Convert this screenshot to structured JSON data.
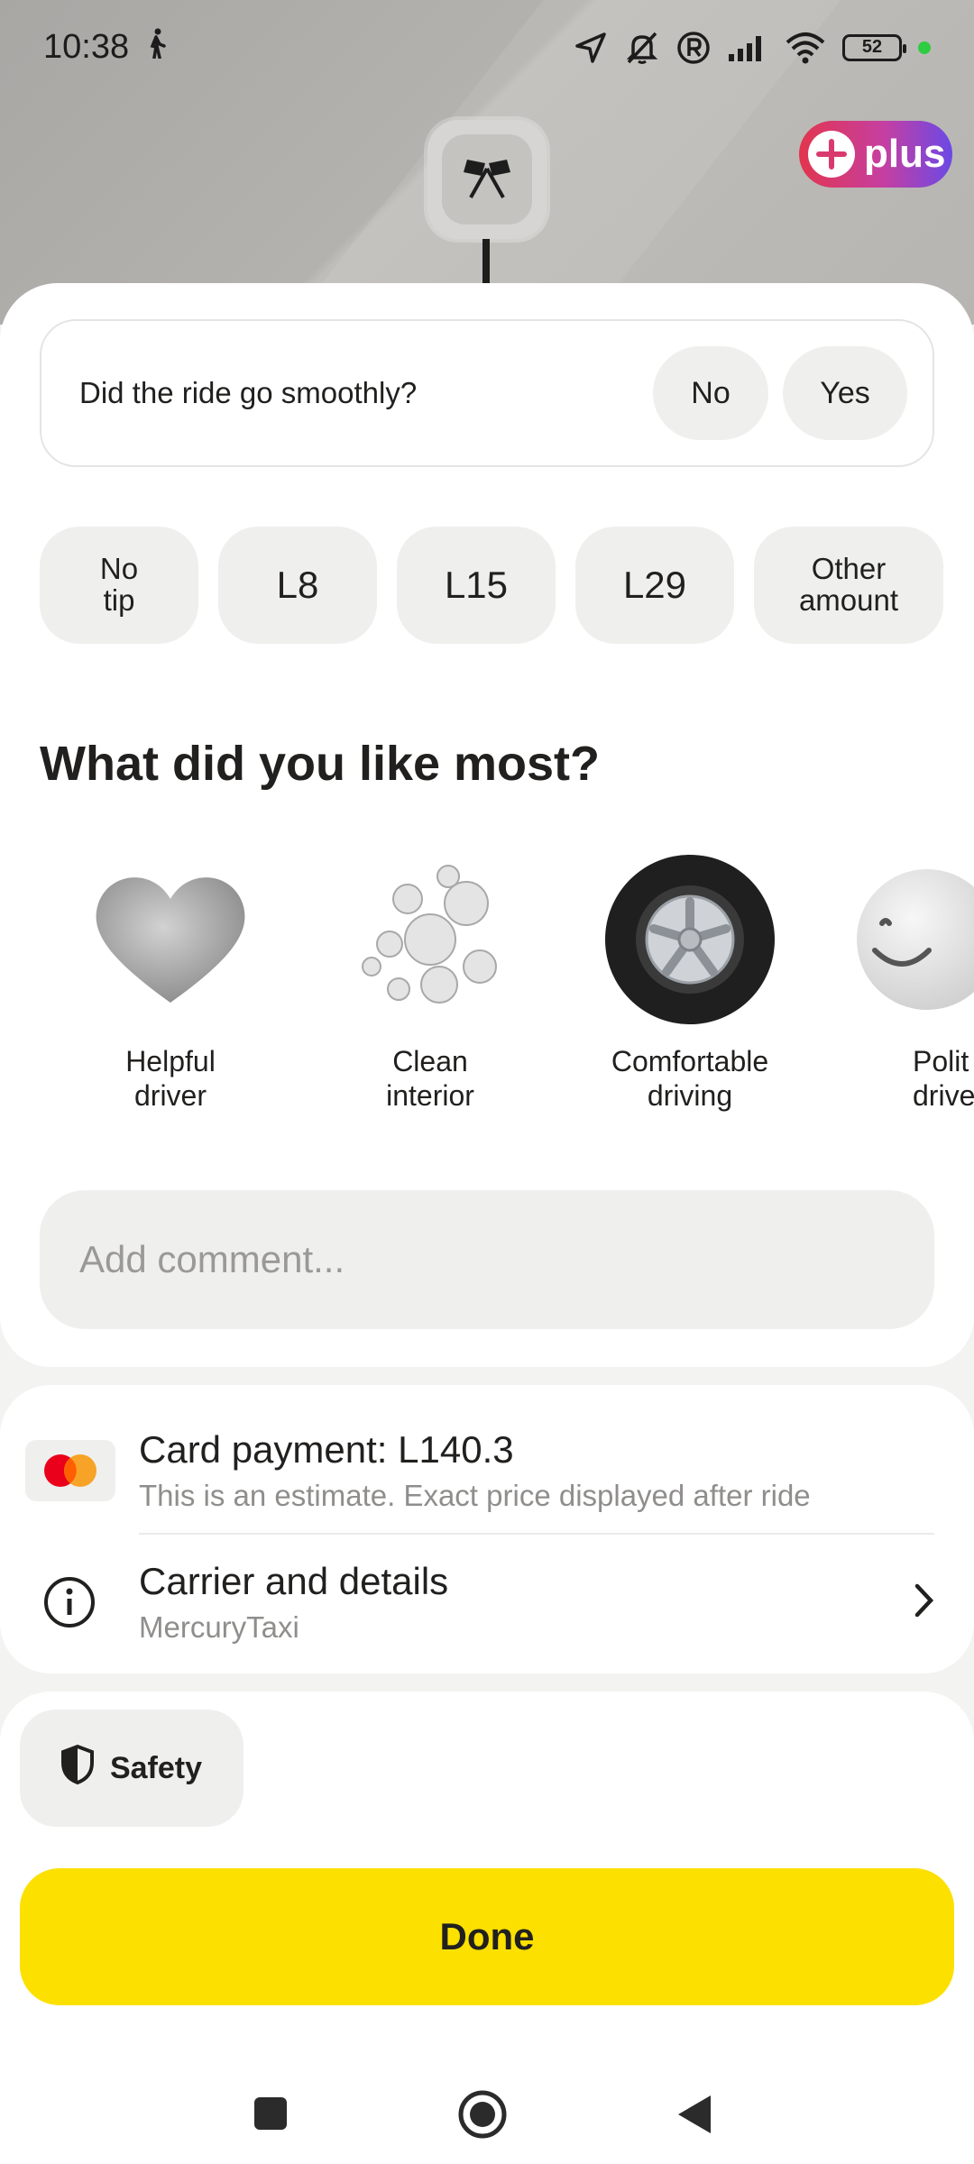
{
  "status_bar": {
    "time": "10:38",
    "battery": "52"
  },
  "plus_badge": {
    "label": "plus"
  },
  "smooth": {
    "question": "Did the ride go smoothly?",
    "no_label": "No",
    "yes_label": "Yes"
  },
  "tips": [
    {
      "line1": "No",
      "line2": "tip"
    },
    {
      "line1": "L8"
    },
    {
      "line1": "L15"
    },
    {
      "line1": "L29"
    },
    {
      "line1": "Other",
      "line2": "amount"
    }
  ],
  "likes": {
    "title": "What did you like most?",
    "items": [
      {
        "line1": "Helpful",
        "line2": "driver",
        "icon": "heart-icon"
      },
      {
        "line1": "Clean",
        "line2": "interior",
        "icon": "bubbles-icon"
      },
      {
        "line1": "Comfortable",
        "line2": "driving",
        "icon": "tire-icon"
      },
      {
        "line1": "Polit",
        "line2": "drive",
        "icon": "smiley-icon"
      }
    ]
  },
  "comment": {
    "placeholder": "Add comment..."
  },
  "payment": {
    "title": "Card payment: L140.3",
    "subtitle": "This is an estimate. Exact price displayed after ride",
    "icon": "mastercard-icon"
  },
  "carrier": {
    "title": "Carrier and details",
    "subtitle": "MercuryTaxi"
  },
  "safety": {
    "label": "Safety"
  },
  "done": {
    "label": "Done"
  },
  "colors": {
    "accent_yellow": "#fce000",
    "pill_gray": "#efefee",
    "text": "#21201f"
  }
}
